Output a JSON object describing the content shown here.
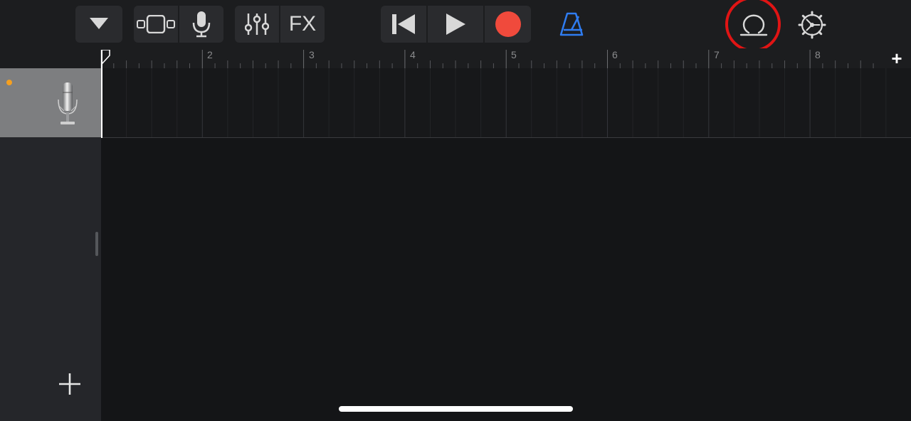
{
  "toolbar": {
    "browser_button": "track-browser",
    "view_button": "track-view",
    "input_button": "microphone",
    "mixer_button": "mixer",
    "fx_label": "FX",
    "transport": {
      "rewind": "go-to-beginning",
      "play": "play",
      "record": "record"
    },
    "metronome": "metronome",
    "loop_browser": "loop-browser",
    "settings": "settings"
  },
  "ruler": {
    "bar_numbers": [
      "2",
      "3",
      "4",
      "5",
      "6",
      "7",
      "8"
    ],
    "add_section_label": "+"
  },
  "tracks": [
    {
      "instrument": "audio-recorder-microphone",
      "active_indicator": true
    }
  ],
  "colors": {
    "record": "#f04a3c",
    "metronome": "#2f7cf0",
    "active_dot": "#f5a020",
    "highlight": "#e01414"
  }
}
